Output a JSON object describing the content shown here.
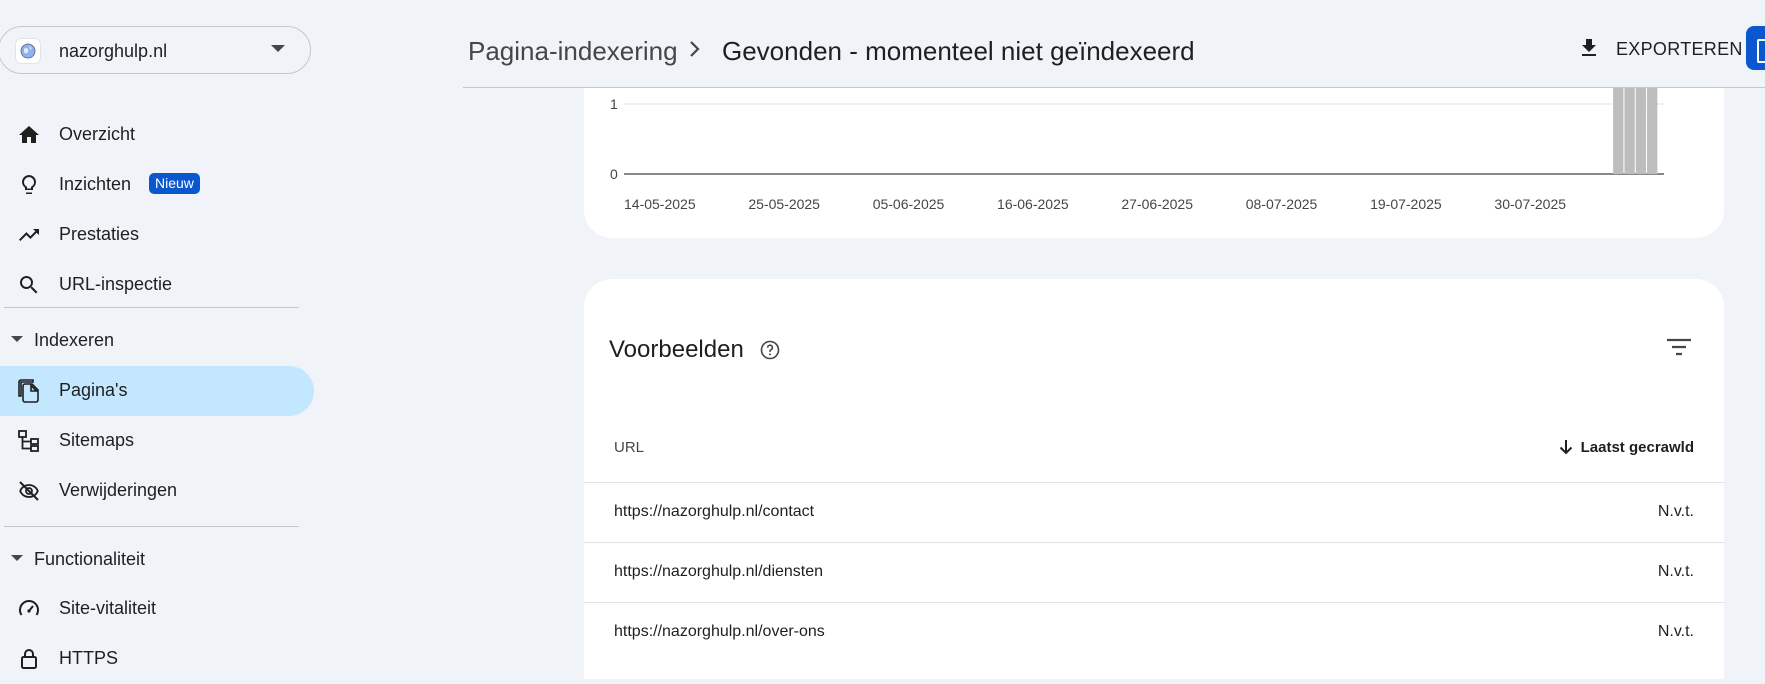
{
  "property": {
    "name": "nazorghulp.nl",
    "icon": "globe-icon"
  },
  "sidebar": {
    "items": [
      {
        "label": "Overzicht",
        "icon": "home-icon"
      },
      {
        "label": "Inzichten",
        "icon": "lightbulb-icon",
        "badge": "Nieuw"
      },
      {
        "label": "Prestaties",
        "icon": "trending-up-icon"
      },
      {
        "label": "URL-inspectie",
        "icon": "search-icon"
      }
    ],
    "sections": [
      {
        "label": "Indexeren",
        "items": [
          {
            "label": "Pagina's",
            "icon": "pages-icon",
            "active": true
          },
          {
            "label": "Sitemaps",
            "icon": "sitemap-icon"
          },
          {
            "label": "Verwijderingen",
            "icon": "eye-off-icon"
          }
        ]
      },
      {
        "label": "Functionaliteit",
        "items": [
          {
            "label": "Site-vitaliteit",
            "icon": "speed-icon"
          },
          {
            "label": "HTTPS",
            "icon": "lock-icon"
          }
        ]
      }
    ]
  },
  "header": {
    "breadcrumb_parent": "Pagina-indexering",
    "title": "Gevonden - momenteel niet geïndexeerd",
    "export_label": "EXPORTEREN"
  },
  "chart_data": {
    "type": "bar",
    "x_ticks": [
      "14-05-2025",
      "25-05-2025",
      "05-06-2025",
      "16-06-2025",
      "27-06-2025",
      "08-07-2025",
      "19-07-2025",
      "30-07-2025"
    ],
    "y_ticks": [
      0,
      1
    ],
    "x_start": "2025-05-14",
    "x_end": "2025-08-14",
    "bars": [
      {
        "date": "2025-08-10",
        "value": 1
      },
      {
        "date": "2025-08-11",
        "value": 1
      },
      {
        "date": "2025-08-12",
        "value": 1
      },
      {
        "date": "2025-08-13",
        "value": 1
      }
    ],
    "bar_color": "#bdbdbd"
  },
  "examples": {
    "title": "Voorbeelden",
    "col_url": "URL",
    "col_sort": "Laatst gecrawld",
    "rows": [
      {
        "url": "https://nazorghulp.nl/contact",
        "crawled": "N.v.t."
      },
      {
        "url": "https://nazorghulp.nl/diensten",
        "crawled": "N.v.t."
      },
      {
        "url": "https://nazorghulp.nl/over-ons",
        "crawled": "N.v.t."
      }
    ]
  },
  "colors": {
    "accent": "#0b57d0",
    "active_nav": "#c2e7ff",
    "background": "#f0f4f9"
  }
}
